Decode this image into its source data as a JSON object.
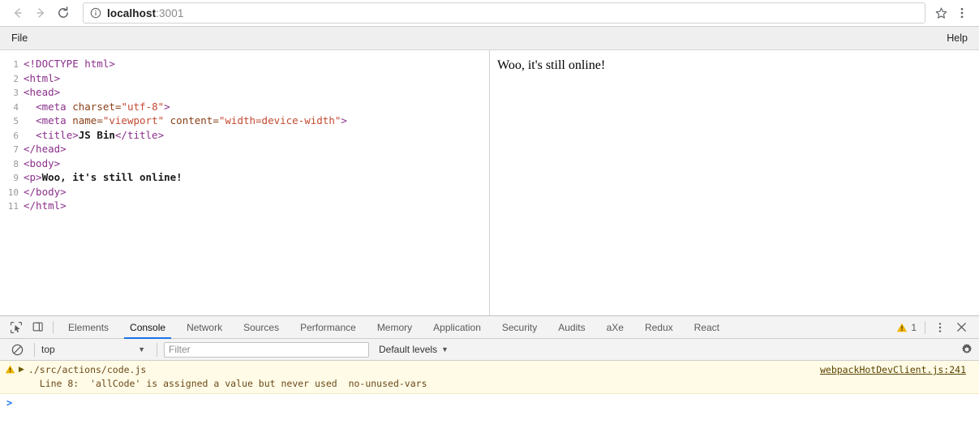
{
  "browser": {
    "back_label": "Back",
    "forward_label": "Forward",
    "reload_label": "Reload",
    "site_info_label": "View site information",
    "url_host": "localhost",
    "url_port": ":3001",
    "bookmark_label": "Bookmark this page",
    "menu_label": "Customize and control Google Chrome"
  },
  "appmenu": {
    "file": "File",
    "help": "Help"
  },
  "editor": {
    "lines": [
      {
        "n": "1",
        "tokens": [
          {
            "t": "doctype",
            "v": "<!DOCTYPE html>"
          }
        ]
      },
      {
        "n": "2",
        "tokens": [
          {
            "t": "tag",
            "v": "<html>"
          }
        ]
      },
      {
        "n": "3",
        "tokens": [
          {
            "t": "tag",
            "v": "<head>"
          }
        ]
      },
      {
        "n": "4",
        "tokens": [
          {
            "t": "plain",
            "v": "  "
          },
          {
            "t": "tag",
            "v": "<meta "
          },
          {
            "t": "attr",
            "v": "charset="
          },
          {
            "t": "str",
            "v": "\"utf-8\""
          },
          {
            "t": "tag",
            "v": ">"
          }
        ]
      },
      {
        "n": "5",
        "tokens": [
          {
            "t": "plain",
            "v": "  "
          },
          {
            "t": "tag",
            "v": "<meta "
          },
          {
            "t": "attr",
            "v": "name="
          },
          {
            "t": "str",
            "v": "\"viewport\""
          },
          {
            "t": "plain",
            "v": " "
          },
          {
            "t": "attr",
            "v": "content="
          },
          {
            "t": "str",
            "v": "\"width=device-width\""
          },
          {
            "t": "tag",
            "v": ">"
          }
        ]
      },
      {
        "n": "6",
        "tokens": [
          {
            "t": "plain",
            "v": "  "
          },
          {
            "t": "tag",
            "v": "<title>"
          },
          {
            "t": "text",
            "v": "JS Bin"
          },
          {
            "t": "tag",
            "v": "</title>"
          }
        ]
      },
      {
        "n": "7",
        "tokens": [
          {
            "t": "tag",
            "v": "</head>"
          }
        ]
      },
      {
        "n": "8",
        "tokens": [
          {
            "t": "tag",
            "v": "<body>"
          }
        ]
      },
      {
        "n": "9",
        "tokens": [
          {
            "t": "tag",
            "v": "<p>"
          },
          {
            "t": "text",
            "v": "Woo, it's still online!"
          }
        ]
      },
      {
        "n": "10",
        "tokens": [
          {
            "t": "tag",
            "v": "</body>"
          }
        ]
      },
      {
        "n": "11",
        "tokens": [
          {
            "t": "tag",
            "v": "</html>"
          }
        ]
      }
    ]
  },
  "preview": {
    "paragraph": "Woo, it's still online!"
  },
  "devtools": {
    "inspect_label": "Inspect element",
    "device_label": "Toggle device toolbar",
    "tabs": [
      {
        "label": "Elements",
        "active": false
      },
      {
        "label": "Console",
        "active": true
      },
      {
        "label": "Network",
        "active": false
      },
      {
        "label": "Sources",
        "active": false
      },
      {
        "label": "Performance",
        "active": false
      },
      {
        "label": "Memory",
        "active": false
      },
      {
        "label": "Application",
        "active": false
      },
      {
        "label": "Security",
        "active": false
      },
      {
        "label": "Audits",
        "active": false
      },
      {
        "label": "aXe",
        "active": false
      },
      {
        "label": "Redux",
        "active": false
      },
      {
        "label": "React",
        "active": false
      }
    ],
    "warning_count": "1",
    "more_label": "More options",
    "close_label": "Close DevTools",
    "filterbar": {
      "clear_label": "Clear console",
      "context": "top",
      "context_caret": "▼",
      "filter_placeholder": "Filter",
      "filter_value": "",
      "levels": "Default levels",
      "levels_caret": "▼",
      "settings_label": "Console settings"
    },
    "messages": [
      {
        "expand": "▶",
        "file": "./src/actions/code.js",
        "detail": "  Line 8:  'allCode' is assigned a value but never used  no-unused-vars",
        "source": "webpackHotDevClient.js:241"
      }
    ],
    "prompt_caret": ">"
  },
  "colors": {
    "accent": "#1a73e8",
    "warning_bg": "#fffbe6",
    "warning_text": "#6b4a1b",
    "warning_icon": "#f0b400",
    "tag": "#8b2f8b",
    "attr": "#8a4019",
    "string": "#c44a33"
  }
}
